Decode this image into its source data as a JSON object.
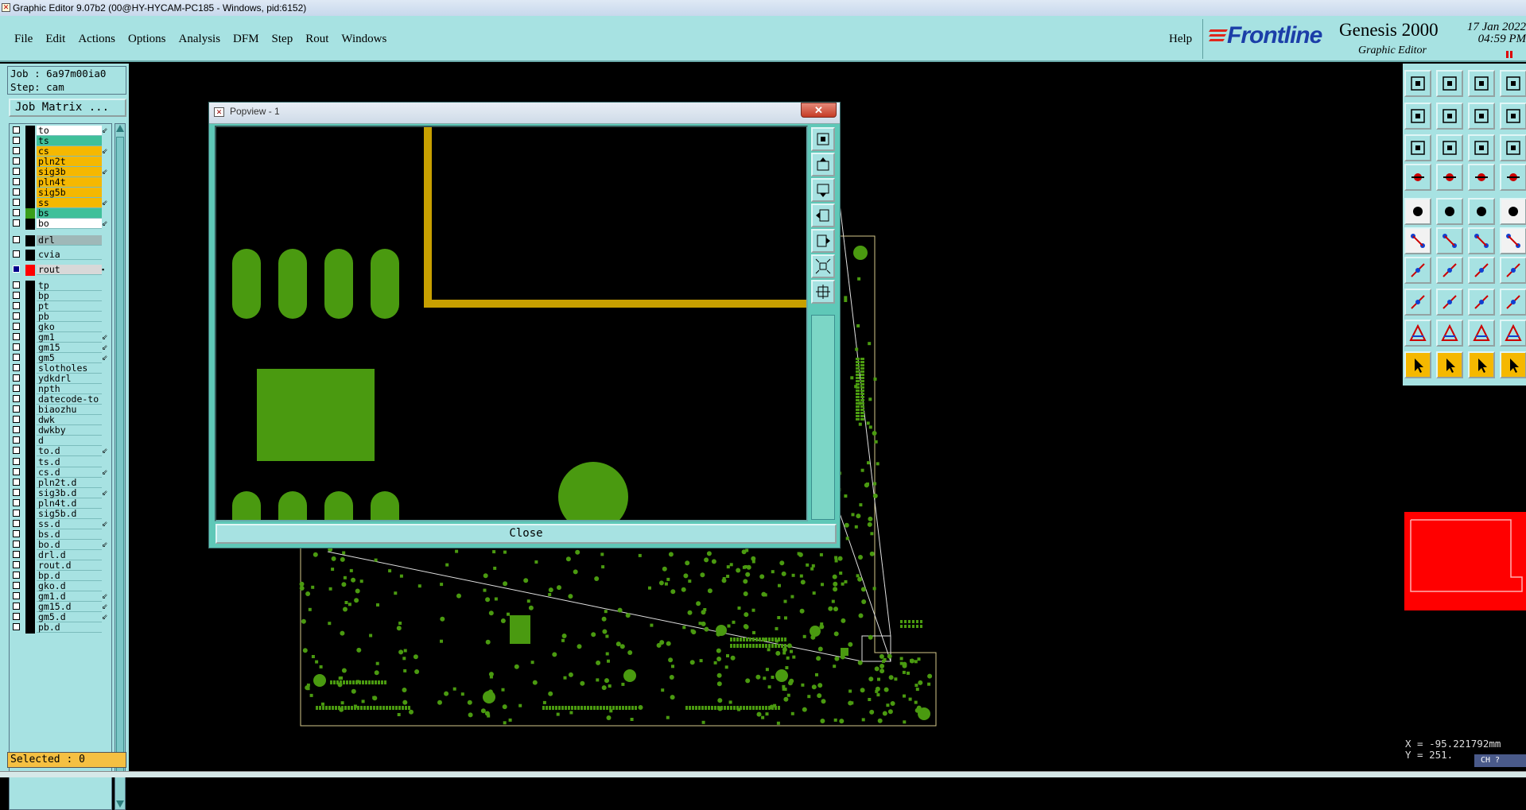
{
  "window": {
    "title": "Graphic Editor 9.07b2 (00@HY-HYCAM-PC185 - Windows, pid:6152)"
  },
  "menu": {
    "items": [
      "File",
      "Edit",
      "Actions",
      "Options",
      "Analysis",
      "DFM",
      "Step",
      "Rout",
      "Windows"
    ],
    "help": "Help"
  },
  "brand": {
    "logo": "Frontline",
    "product": "Genesis 2000",
    "subtitle": "Graphic Editor",
    "date": "17 Jan 2022",
    "time": "04:59 PM"
  },
  "job": {
    "job_line": "Job : 6a97m00ia0",
    "step_line": "Step: cam",
    "matrix_button": "Job Matrix ..."
  },
  "layers": [
    {
      "name": "to",
      "color": "#ffffff",
      "mark": "⇙"
    },
    {
      "name": "ts",
      "color": "#3fc09a",
      "mark": ""
    },
    {
      "name": "cs",
      "color": "#f5b800",
      "mark": "⇙"
    },
    {
      "name": "pln2t",
      "color": "#f5b800",
      "mark": ""
    },
    {
      "name": "sig3b",
      "color": "#f5b800",
      "mark": "⇙"
    },
    {
      "name": "pln4t",
      "color": "#f5b800",
      "mark": ""
    },
    {
      "name": "sig5b",
      "color": "#f5b800",
      "mark": ""
    },
    {
      "name": "ss",
      "color": "#f5b800",
      "mark": "⇙"
    },
    {
      "name": "bs",
      "color": "#3fc09a",
      "mark": ""
    },
    {
      "name": "bo",
      "color": "#ffffff",
      "mark": "⇙"
    },
    {
      "name": "drl",
      "color": "#9fb8b8",
      "mark": ""
    },
    {
      "name": "cvia",
      "color": "#a7e2e2",
      "mark": ""
    },
    {
      "name": "rout",
      "color": "#d8d8d8",
      "mark": "▪"
    },
    {
      "name": "tp",
      "color": "#a7e2e2",
      "mark": ""
    },
    {
      "name": "bp",
      "color": "#a7e2e2",
      "mark": ""
    },
    {
      "name": "pt",
      "color": "#a7e2e2",
      "mark": ""
    },
    {
      "name": "pb",
      "color": "#a7e2e2",
      "mark": ""
    },
    {
      "name": "gko",
      "color": "#a7e2e2",
      "mark": ""
    },
    {
      "name": "gm1",
      "color": "#a7e2e2",
      "mark": "⇙"
    },
    {
      "name": "gm15",
      "color": "#a7e2e2",
      "mark": "⇙"
    },
    {
      "name": "gm5",
      "color": "#a7e2e2",
      "mark": "⇙"
    },
    {
      "name": "slotholes",
      "color": "#a7e2e2",
      "mark": ""
    },
    {
      "name": "ydkdrl",
      "color": "#a7e2e2",
      "mark": ""
    },
    {
      "name": "npth",
      "color": "#a7e2e2",
      "mark": ""
    },
    {
      "name": "datecode-to",
      "color": "#a7e2e2",
      "mark": ""
    },
    {
      "name": "biaozhu",
      "color": "#a7e2e2",
      "mark": ""
    },
    {
      "name": "dwk",
      "color": "#a7e2e2",
      "mark": ""
    },
    {
      "name": "dwkby",
      "color": "#a7e2e2",
      "mark": ""
    },
    {
      "name": "d",
      "color": "#a7e2e2",
      "mark": ""
    },
    {
      "name": "to.d",
      "color": "#a7e2e2",
      "mark": "⇙"
    },
    {
      "name": "ts.d",
      "color": "#a7e2e2",
      "mark": ""
    },
    {
      "name": "cs.d",
      "color": "#a7e2e2",
      "mark": "⇙"
    },
    {
      "name": "pln2t.d",
      "color": "#a7e2e2",
      "mark": ""
    },
    {
      "name": "sig3b.d",
      "color": "#a7e2e2",
      "mark": "⇙"
    },
    {
      "name": "pln4t.d",
      "color": "#a7e2e2",
      "mark": ""
    },
    {
      "name": "sig5b.d",
      "color": "#a7e2e2",
      "mark": ""
    },
    {
      "name": "ss.d",
      "color": "#a7e2e2",
      "mark": "⇙"
    },
    {
      "name": "bs.d",
      "color": "#a7e2e2",
      "mark": ""
    },
    {
      "name": "bo.d",
      "color": "#a7e2e2",
      "mark": "⇙"
    },
    {
      "name": "drl.d",
      "color": "#a7e2e2",
      "mark": ""
    },
    {
      "name": "rout.d",
      "color": "#a7e2e2",
      "mark": ""
    },
    {
      "name": "bp.d",
      "color": "#a7e2e2",
      "mark": ""
    },
    {
      "name": "gko.d",
      "color": "#a7e2e2",
      "mark": ""
    },
    {
      "name": "gm1.d",
      "color": "#a7e2e2",
      "mark": "⇙"
    },
    {
      "name": "gm15.d",
      "color": "#a7e2e2",
      "mark": "⇙"
    },
    {
      "name": "gm5.d",
      "color": "#a7e2e2",
      "mark": "⇙"
    },
    {
      "name": "pb.d",
      "color": "#a7e2e2",
      "mark": ""
    }
  ],
  "status": {
    "selected": "Selected : 0",
    "x": "X = -95.221792mm",
    "y": "Y = 251.",
    "ime": "CH ?"
  },
  "popview": {
    "title": "Popview - 1",
    "close_button": "Close",
    "close_x": "✕"
  },
  "colors": {
    "ui_teal": "#a7e2e2",
    "pad_green": "#4a9a10",
    "trace_gold": "#c8a000",
    "outline": "#d4c88a",
    "minimap_red": "#ff0000"
  }
}
